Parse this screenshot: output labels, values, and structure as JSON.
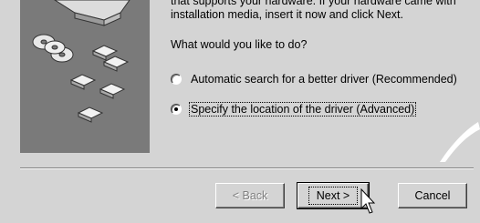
{
  "intro": {
    "line1": "that supports your hardware. If your hardware came with",
    "line2": "installation media, insert it now and click Next."
  },
  "question": "What would you like to do?",
  "options": [
    {
      "label": "Automatic search for a better driver (Recommended)",
      "selected": false
    },
    {
      "label": "Specify the location of the driver (Advanced)",
      "selected": true
    }
  ],
  "buttons": {
    "back": "< Back",
    "next": "Next >",
    "cancel": "Cancel"
  }
}
